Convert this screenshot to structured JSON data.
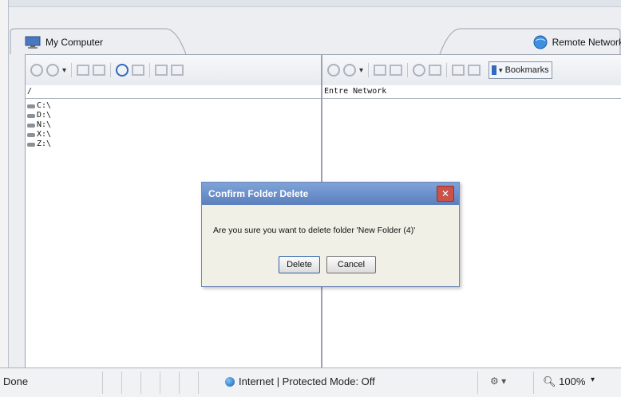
{
  "window": {
    "left_tab": {
      "label": "My Computer",
      "icon": "monitor-icon"
    },
    "right_tab": {
      "label": "Remote Network",
      "icon": "network-globe-icon"
    }
  },
  "left_pane": {
    "path": "/",
    "drives": [
      "C:\\",
      "D:\\",
      "N:\\",
      "X:\\",
      "Z:\\"
    ]
  },
  "right_pane": {
    "path": "Entre Network",
    "bookmarks_label": "Bookmarks"
  },
  "dialog": {
    "title": "Confirm Folder Delete",
    "close": "✕",
    "message": "Are you sure you want to delete folder 'New Folder (4)'",
    "delete_label": "Delete",
    "cancel_label": "Cancel"
  },
  "statusbar": {
    "status": "Done",
    "zone": "Internet | Protected Mode: Off",
    "zoom": "100%"
  }
}
